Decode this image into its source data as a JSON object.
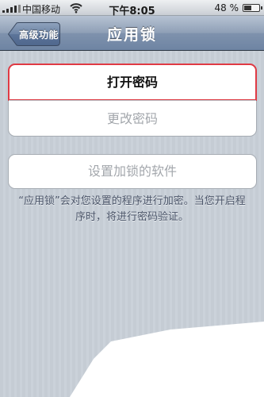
{
  "status_bar": {
    "carrier": "中国移动",
    "time": "下午8:05",
    "battery_percent": "48 %",
    "battery_level": 0.48,
    "icons": [
      "signal-icon",
      "wifi-icon",
      "battery-icon"
    ]
  },
  "nav": {
    "back_label": "高级功能",
    "title": "应用锁"
  },
  "password_group": {
    "open_password": "打开密码",
    "change_password": "更改密码"
  },
  "apps_group": {
    "set_locked_apps": "设置加锁的软件"
  },
  "footnote": "“应用锁”会对您设置的程序进行加密。当您开启程序时，将进行密码验证。",
  "colors": {
    "highlight_border": "#e03a44",
    "disabled_text": "#a3a7ac",
    "nav_bar": "#7f92ad",
    "background": "#c5ccd4"
  }
}
